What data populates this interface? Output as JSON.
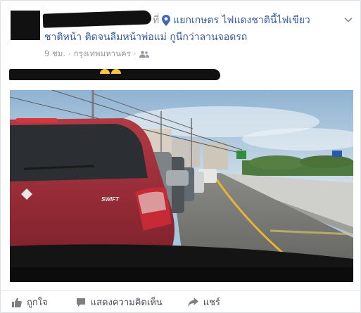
{
  "post": {
    "at_word": "ที่",
    "place": "แยกเกษตร ไฟแดงชาตินี้ไฟเขียว",
    "place_line2": "ชาติหน้า ติดจนลืมหน้าพ่อแม่ กูนีกว่าลานจอดรถ",
    "time": "9 ชม.",
    "separator": "·",
    "location": "กรุงเทพมหานคร",
    "separator2": "·"
  },
  "actions": {
    "like_label": "ถูกใจ",
    "comment_label": "แสดงความคิดเห็น",
    "share_label": "แชร์"
  },
  "colors": {
    "link": "#365899",
    "meta": "#90949c",
    "action": "#4b4f56",
    "car": "#9b2f3a"
  },
  "icons": {
    "location": "pin-icon",
    "audience": "friends-icon",
    "options": "chevron-down-icon",
    "like": "thumbs-up-icon",
    "comment": "comment-icon",
    "share": "share-arrow-icon"
  }
}
